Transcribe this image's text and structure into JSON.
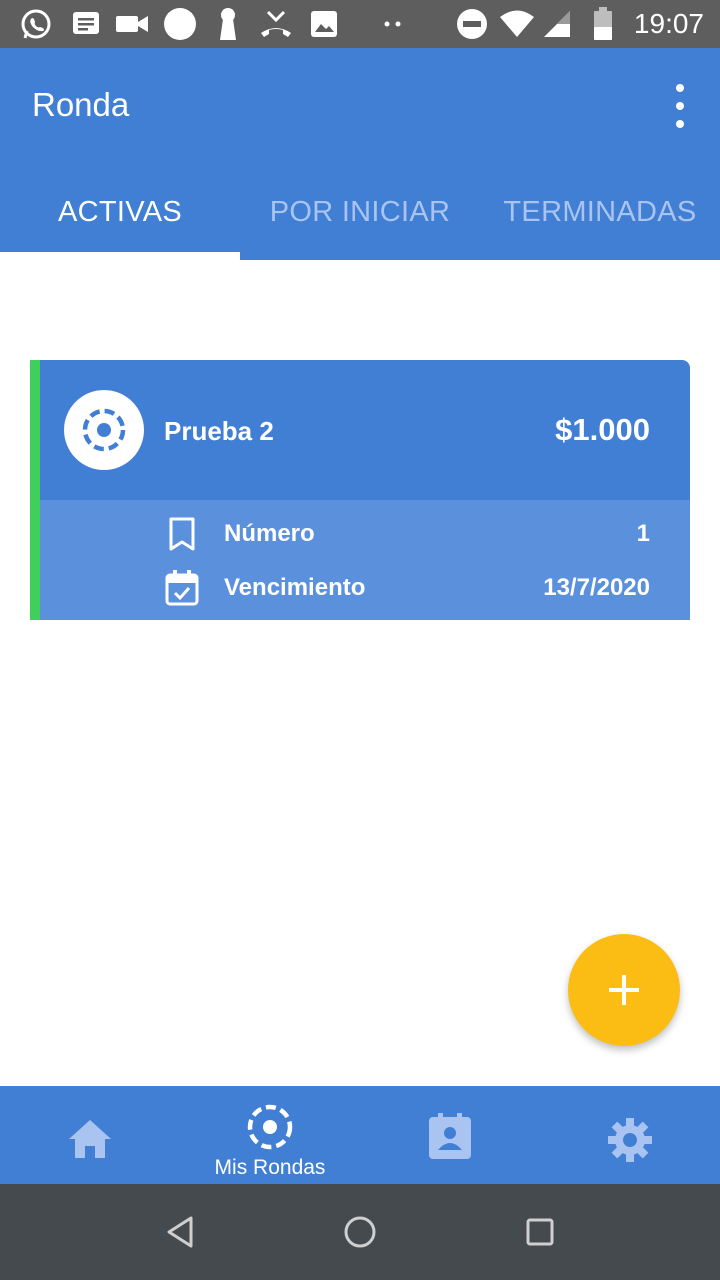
{
  "status_bar": {
    "time": "19:07",
    "icons": [
      "whatsapp-icon",
      "message-icon",
      "video-icon",
      "circle-icon",
      "keyhole-icon",
      "missed-call-icon",
      "image-icon",
      "dots-icon",
      "do-not-disturb-icon",
      "wifi-icon",
      "signal-icon",
      "battery-icon"
    ]
  },
  "app_bar": {
    "title": "Ronda",
    "menu_icon": "more-vert-icon"
  },
  "tabs": [
    {
      "label": "ACTIVAS",
      "active": true
    },
    {
      "label": "POR INICIAR",
      "active": false
    },
    {
      "label": "TERMINADAS",
      "active": false
    }
  ],
  "card": {
    "icon": "ronda-circle-icon",
    "title": "Prueba 2",
    "amount": "$1.000",
    "accent_color": "#3fcf5a",
    "rows": [
      {
        "icon": "bookmark-icon",
        "label": "Número",
        "value": "1"
      },
      {
        "icon": "calendar-check-icon",
        "label": "Vencimiento",
        "value": "13/7/2020"
      }
    ]
  },
  "fab": {
    "icon": "plus-icon",
    "color": "#fbbd14"
  },
  "bottom_nav": {
    "items": [
      {
        "icon": "home-icon",
        "label": ""
      },
      {
        "icon": "ronda-circle-icon",
        "label": "Mis Rondas"
      },
      {
        "icon": "contact-calendar-icon",
        "label": ""
      },
      {
        "icon": "settings-icon",
        "label": ""
      }
    ]
  },
  "colors": {
    "primary": "#417fd4",
    "card_secondary": "#5b90dc",
    "tab_inactive": "#a9c4f0",
    "status_bar": "#5e5e5e",
    "system_nav": "#454a4f"
  }
}
